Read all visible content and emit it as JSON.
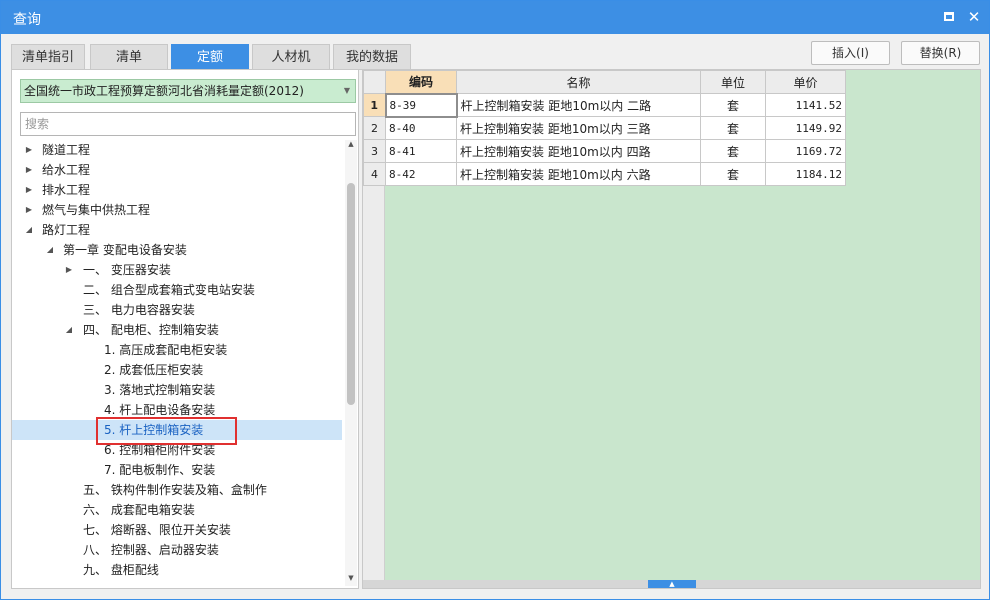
{
  "window": {
    "title": "查询",
    "maximize_icon": "maximize-icon",
    "close_label": "✕"
  },
  "tabs": [
    {
      "label": "清单指引",
      "active": false
    },
    {
      "label": "清单",
      "active": false
    },
    {
      "label": "定额",
      "active": true
    },
    {
      "label": "人材机",
      "active": false
    },
    {
      "label": "我的数据",
      "active": false
    }
  ],
  "actions": {
    "insert_label": "插入(I)",
    "replace_label": "替换(R)"
  },
  "library_select": {
    "value": "全国统一市政工程预算定额河北省消耗量定额(2012)"
  },
  "search": {
    "placeholder": "搜索"
  },
  "tree": [
    {
      "label": "隧道工程",
      "level": 0,
      "toggle": "collapsed"
    },
    {
      "label": "给水工程",
      "level": 0,
      "toggle": "collapsed"
    },
    {
      "label": "排水工程",
      "level": 0,
      "toggle": "collapsed"
    },
    {
      "label": "燃气与集中供热工程",
      "level": 0,
      "toggle": "collapsed"
    },
    {
      "label": "路灯工程",
      "level": 0,
      "toggle": "expanded"
    },
    {
      "label": "第一章 变配电设备安装",
      "level": 1,
      "toggle": "expanded"
    },
    {
      "label": "一、 变压器安装",
      "level": 2,
      "toggle": "collapsed"
    },
    {
      "label": "二、 组合型成套箱式变电站安装",
      "level": 2,
      "toggle": "none"
    },
    {
      "label": "三、 电力电容器安装",
      "level": 2,
      "toggle": "none"
    },
    {
      "label": "四、 配电柜、控制箱安装",
      "level": 2,
      "toggle": "expanded"
    },
    {
      "label": "1. 高压成套配电柜安装",
      "level": 3,
      "toggle": "none"
    },
    {
      "label": "2. 成套低压柜安装",
      "level": 3,
      "toggle": "none"
    },
    {
      "label": "3. 落地式控制箱安装",
      "level": 3,
      "toggle": "none"
    },
    {
      "label": "4. 杆上配电设备安装",
      "level": 3,
      "toggle": "none"
    },
    {
      "label": "5. 杆上控制箱安装",
      "level": 3,
      "toggle": "none",
      "selected": true
    },
    {
      "label": "6. 控制箱柜附件安装",
      "level": 3,
      "toggle": "none"
    },
    {
      "label": "7. 配电板制作、安装",
      "level": 3,
      "toggle": "none"
    },
    {
      "label": "五、 铁构件制作安装及箱、盒制作",
      "level": 2,
      "toggle": "none"
    },
    {
      "label": "六、 成套配电箱安装",
      "level": 2,
      "toggle": "none"
    },
    {
      "label": "七、 熔断器、限位开关安装",
      "level": 2,
      "toggle": "none"
    },
    {
      "label": "八、 控制器、启动器安装",
      "level": 2,
      "toggle": "none"
    },
    {
      "label": "九、 盘柜配线",
      "level": 2,
      "toggle": "none"
    }
  ],
  "grid": {
    "headers": {
      "code": "编码",
      "name": "名称",
      "unit": "单位",
      "price": "单价"
    },
    "rows": [
      {
        "num": "1",
        "code": "8-39",
        "name": "杆上控制箱安装 距地10m以内 二路",
        "unit": "套",
        "price": "1141.52"
      },
      {
        "num": "2",
        "code": "8-40",
        "name": "杆上控制箱安装 距地10m以内 三路",
        "unit": "套",
        "price": "1149.92"
      },
      {
        "num": "3",
        "code": "8-41",
        "name": "杆上控制箱安装 距地10m以内 四路",
        "unit": "套",
        "price": "1169.72"
      },
      {
        "num": "4",
        "code": "8-42",
        "name": "杆上控制箱安装 距地10m以内 六路",
        "unit": "套",
        "price": "1184.12"
      }
    ]
  },
  "colors": {
    "accent": "#3d8fe4",
    "grid_bg": "#c9e6cd",
    "active_header": "#f9dfb7",
    "highlight": "#e03030"
  }
}
